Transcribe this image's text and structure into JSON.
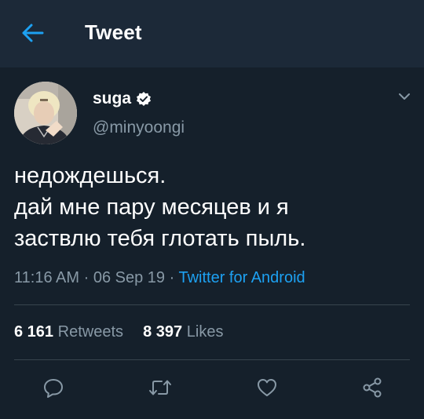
{
  "header": {
    "title": "Tweet",
    "back_icon": "arrow-left-icon"
  },
  "author": {
    "display_name": "suga",
    "handle": "@minyoongi",
    "verified": true
  },
  "tweet": {
    "text_lines": [
      "недождешься.",
      "дай мне пару месяцев и я",
      "заствлю тебя глотать пыль."
    ],
    "time": "11:16 AM",
    "date": "06 Sep 19",
    "separator": "·",
    "source": "Twitter for Android"
  },
  "stats": {
    "retweets_count": "6 161",
    "retweets_label": "Retweets",
    "likes_count": "8 397",
    "likes_label": "Likes"
  },
  "actions": [
    "reply-icon",
    "retweet-icon",
    "like-icon",
    "share-icon"
  ],
  "colors": {
    "background": "#15202b",
    "header_bar": "#1c2938",
    "accent": "#1da1f2",
    "secondary_text": "#8899a6",
    "divider": "#38444d"
  }
}
